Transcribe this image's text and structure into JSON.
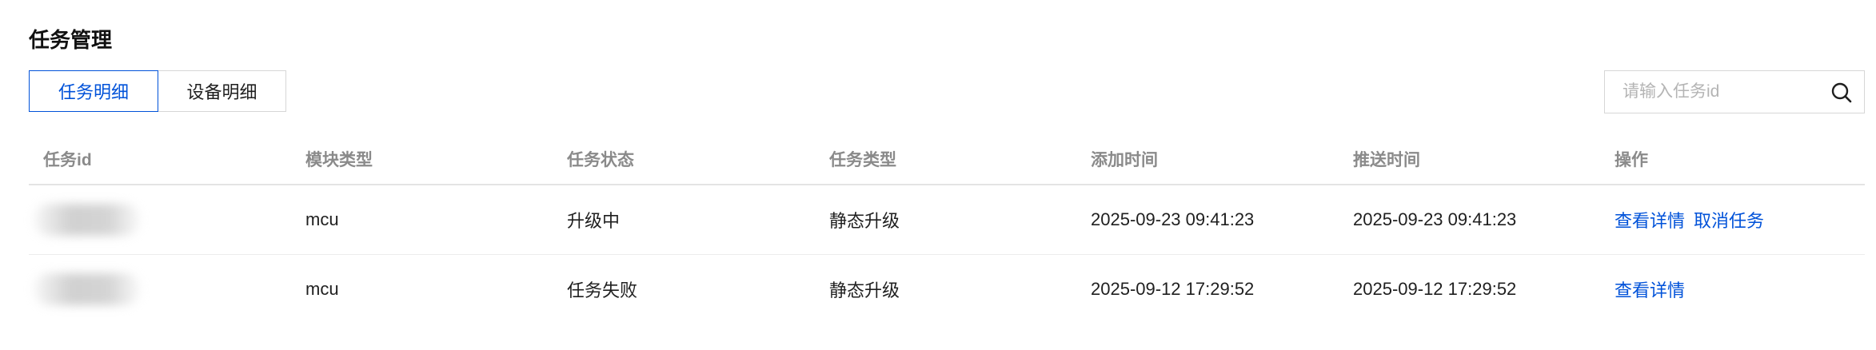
{
  "page": {
    "title": "任务管理"
  },
  "tabs": [
    {
      "label": "任务明细",
      "active": true
    },
    {
      "label": "设备明细",
      "active": false
    }
  ],
  "search": {
    "placeholder": "请输入任务id",
    "value": ""
  },
  "table": {
    "columns": [
      "任务id",
      "模块类型",
      "任务状态",
      "任务类型",
      "添加时间",
      "推送时间",
      "操作"
    ],
    "rows": [
      {
        "task_id": "",
        "module": "mcu",
        "status": "升级中",
        "type": "静态升级",
        "added": "2025-09-23 09:41:23",
        "pushed": "2025-09-23 09:41:23",
        "actions": [
          "查看详情",
          "取消任务"
        ]
      },
      {
        "task_id": "",
        "module": "mcu",
        "status": "任务失败",
        "type": "静态升级",
        "added": "2025-09-12 17:29:52",
        "pushed": "2025-09-12 17:29:52",
        "actions": [
          "查看详情"
        ]
      }
    ]
  },
  "icons": {
    "search": "search-icon"
  },
  "colors": {
    "accent": "#0052d9",
    "border": "#d6d6d6",
    "header_text": "#8a8a8a"
  }
}
